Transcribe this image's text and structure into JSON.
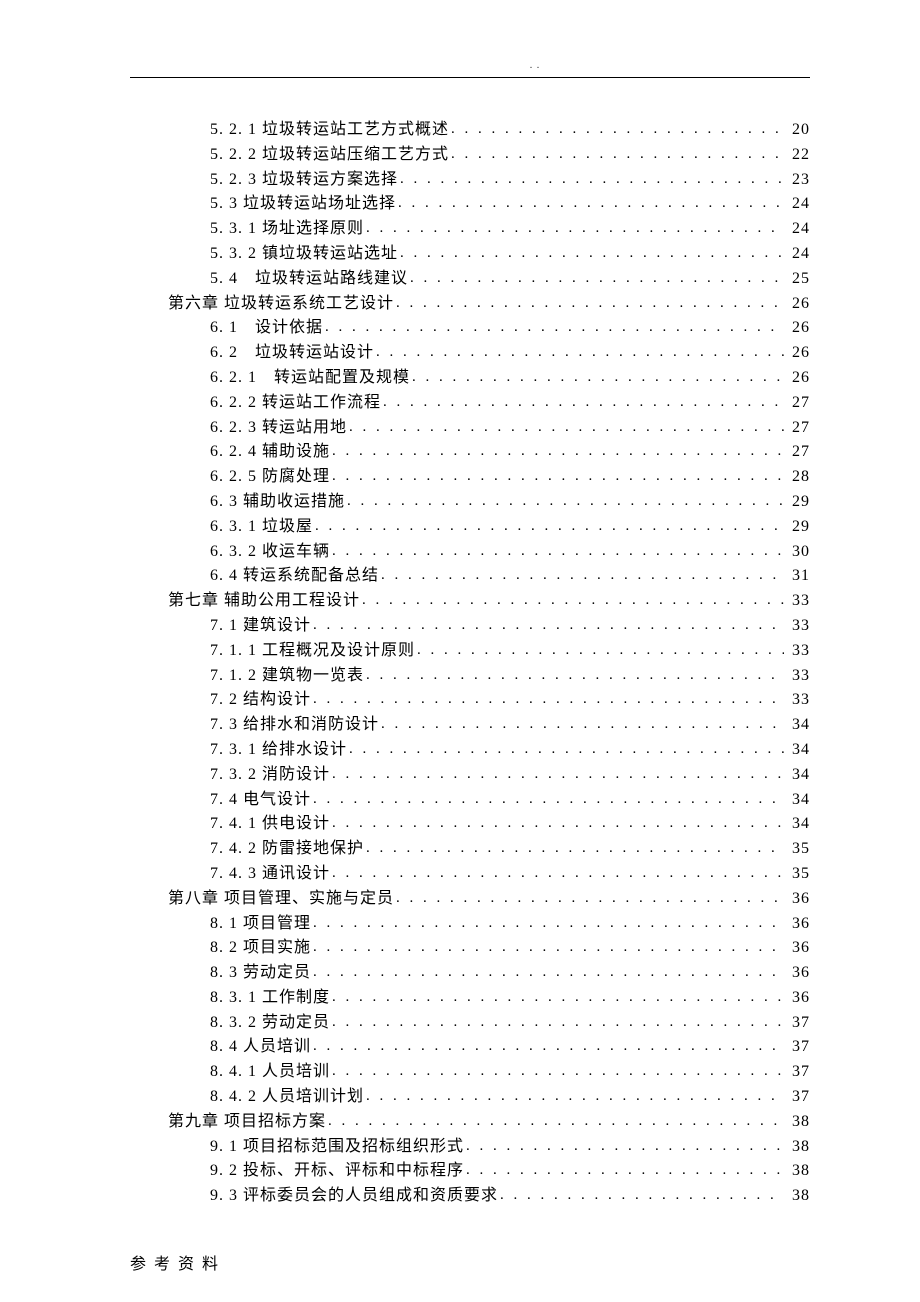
{
  "header_dots": ". .",
  "footer": "参 考 资 料",
  "toc": [
    {
      "level": 2,
      "label": "5. 2. 1 垃圾转运站工艺方式概述",
      "page": "20"
    },
    {
      "level": 2,
      "label": "5. 2. 2 垃圾转运站压缩工艺方式",
      "page": "22"
    },
    {
      "level": 2,
      "label": "5. 2. 3 垃圾转运方案选择",
      "page": "23"
    },
    {
      "level": 2,
      "label": "5. 3 垃圾转运站场址选择",
      "page": "24"
    },
    {
      "level": 2,
      "label": "5. 3. 1 场址选择原则",
      "page": "24"
    },
    {
      "level": 2,
      "label": "5. 3. 2 镇垃圾转运站选址",
      "page": "24"
    },
    {
      "level": 2,
      "label": "5. 4　垃圾转运站路线建议",
      "page": "25"
    },
    {
      "level": 1,
      "label": "第六章 垃圾转运系统工艺设计",
      "page": "26"
    },
    {
      "level": 2,
      "label": "6. 1　设计依据",
      "page": "26"
    },
    {
      "level": 2,
      "label": "6. 2　垃圾转运站设计",
      "page": "26"
    },
    {
      "level": 2,
      "label": "6. 2. 1　转运站配置及规模",
      "page": "26"
    },
    {
      "level": 2,
      "label": "6. 2. 2 转运站工作流程",
      "page": "27"
    },
    {
      "level": 2,
      "label": "6. 2. 3 转运站用地",
      "page": "27"
    },
    {
      "level": 2,
      "label": "6. 2. 4 辅助设施",
      "page": "27"
    },
    {
      "level": 2,
      "label": "6. 2. 5 防腐处理",
      "page": "28"
    },
    {
      "level": 2,
      "label": "6. 3 辅助收运措施",
      "page": "29"
    },
    {
      "level": 2,
      "label": "6. 3. 1 垃圾屋",
      "page": "29"
    },
    {
      "level": 2,
      "label": "6. 3. 2 收运车辆",
      "page": "30"
    },
    {
      "level": 2,
      "label": "6. 4 转运系统配备总结",
      "page": "31"
    },
    {
      "level": 1,
      "label": "第七章 辅助公用工程设计",
      "page": "33"
    },
    {
      "level": 2,
      "label": "7. 1 建筑设计",
      "page": "33"
    },
    {
      "level": 2,
      "label": "7. 1. 1 工程概况及设计原则",
      "page": "33"
    },
    {
      "level": 2,
      "label": "7. 1. 2 建筑物一览表",
      "page": "33"
    },
    {
      "level": 2,
      "label": "7. 2 结构设计",
      "page": "33"
    },
    {
      "level": 2,
      "label": "7. 3 给排水和消防设计",
      "page": "34"
    },
    {
      "level": 2,
      "label": "7. 3. 1 给排水设计",
      "page": "34"
    },
    {
      "level": 2,
      "label": "7. 3. 2 消防设计",
      "page": "34"
    },
    {
      "level": 2,
      "label": "7. 4 电气设计",
      "page": "34"
    },
    {
      "level": 2,
      "label": "7. 4. 1 供电设计",
      "page": "34"
    },
    {
      "level": 2,
      "label": "7. 4. 2 防雷接地保护",
      "page": "35"
    },
    {
      "level": 2,
      "label": "7. 4. 3 通讯设计",
      "page": "35"
    },
    {
      "level": 1,
      "label": "第八章 项目管理、实施与定员",
      "page": "36"
    },
    {
      "level": 2,
      "label": "8. 1 项目管理",
      "page": "36"
    },
    {
      "level": 2,
      "label": "8. 2 项目实施",
      "page": "36"
    },
    {
      "level": 2,
      "label": "8. 3 劳动定员",
      "page": "36"
    },
    {
      "level": 2,
      "label": "8. 3. 1 工作制度",
      "page": "36"
    },
    {
      "level": 2,
      "label": "8. 3. 2 劳动定员",
      "page": "37"
    },
    {
      "level": 2,
      "label": "8. 4 人员培训",
      "page": "37"
    },
    {
      "level": 2,
      "label": "8. 4. 1 人员培训",
      "page": "37"
    },
    {
      "level": 2,
      "label": "8. 4. 2 人员培训计划",
      "page": "37"
    },
    {
      "level": 1,
      "label": "第九章 项目招标方案",
      "page": "38"
    },
    {
      "level": 2,
      "label": "9. 1 项目招标范围及招标组织形式",
      "page": "38"
    },
    {
      "level": 2,
      "label": "9. 2 投标、开标、评标和中标程序",
      "page": "38"
    },
    {
      "level": 2,
      "label": "9. 3 评标委员会的人员组成和资质要求",
      "page": "38"
    }
  ]
}
